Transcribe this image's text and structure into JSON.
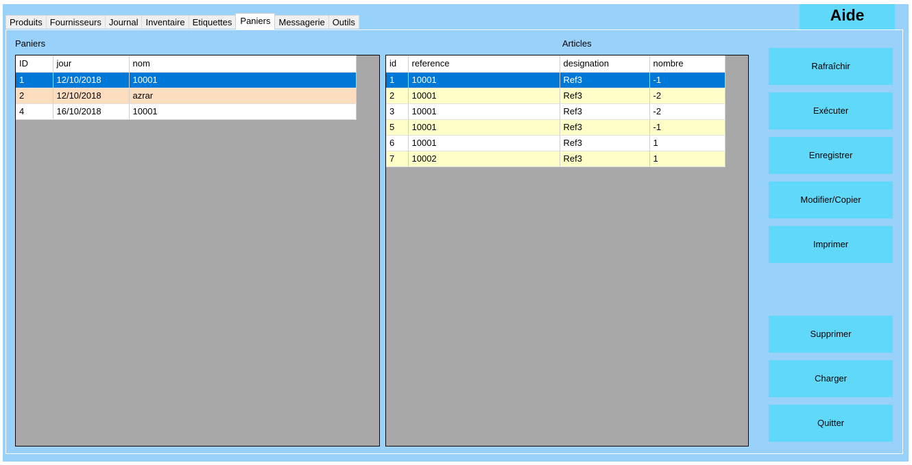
{
  "help": {
    "label": "Aide"
  },
  "tabs": [
    {
      "label": "Produits",
      "active": false
    },
    {
      "label": "Fournisseurs",
      "active": false
    },
    {
      "label": "Journal",
      "active": false
    },
    {
      "label": "Inventaire",
      "active": false
    },
    {
      "label": "Etiquettes",
      "active": false
    },
    {
      "label": "Paniers",
      "active": true
    },
    {
      "label": "Messagerie",
      "active": false
    },
    {
      "label": "Outils",
      "active": false
    }
  ],
  "paniers": {
    "caption": "Paniers",
    "columns": [
      "ID",
      "jour",
      "nom"
    ],
    "rows": [
      {
        "cells": [
          "1",
          "12/10/2018",
          "10001"
        ],
        "style": "selected"
      },
      {
        "cells": [
          "2",
          "12/10/2018",
          "azrar"
        ],
        "style": "highlight"
      },
      {
        "cells": [
          "4",
          "16/10/2018",
          "10001"
        ],
        "style": "normal"
      }
    ]
  },
  "articles": {
    "caption": "Articles",
    "columns": [
      "id",
      "reference",
      "designation",
      "nombre"
    ],
    "rows": [
      {
        "cells": [
          "1",
          "10001",
          "Ref3",
          "-1"
        ],
        "style": "selected"
      },
      {
        "cells": [
          "2",
          "10001",
          "Ref3",
          "-2"
        ],
        "style": "alt"
      },
      {
        "cells": [
          "3",
          "10001",
          "Ref3",
          "-2"
        ],
        "style": "normal"
      },
      {
        "cells": [
          "5",
          "10001",
          "Ref3",
          "-1"
        ],
        "style": "alt"
      },
      {
        "cells": [
          "6",
          "10001",
          "Ref3",
          "1"
        ],
        "style": "normal"
      },
      {
        "cells": [
          "7",
          "10002",
          "Ref3",
          "1"
        ],
        "style": "alt"
      }
    ]
  },
  "actions": {
    "refresh": "Rafraîchir",
    "execute": "Exécuter",
    "save": "Enregistrer",
    "edit_copy": "Modifier/Copier",
    "print": "Imprimer",
    "delete": "Supprimer",
    "load": "Charger",
    "quit": "Quitter"
  },
  "colors": {
    "background": "#99d1fb",
    "button": "#5fd8f9",
    "selected_row": "#0078d7",
    "highlight_row": "#fdddc0",
    "alt_row": "#fffdc8",
    "grid_empty": "#a8a8a8"
  }
}
